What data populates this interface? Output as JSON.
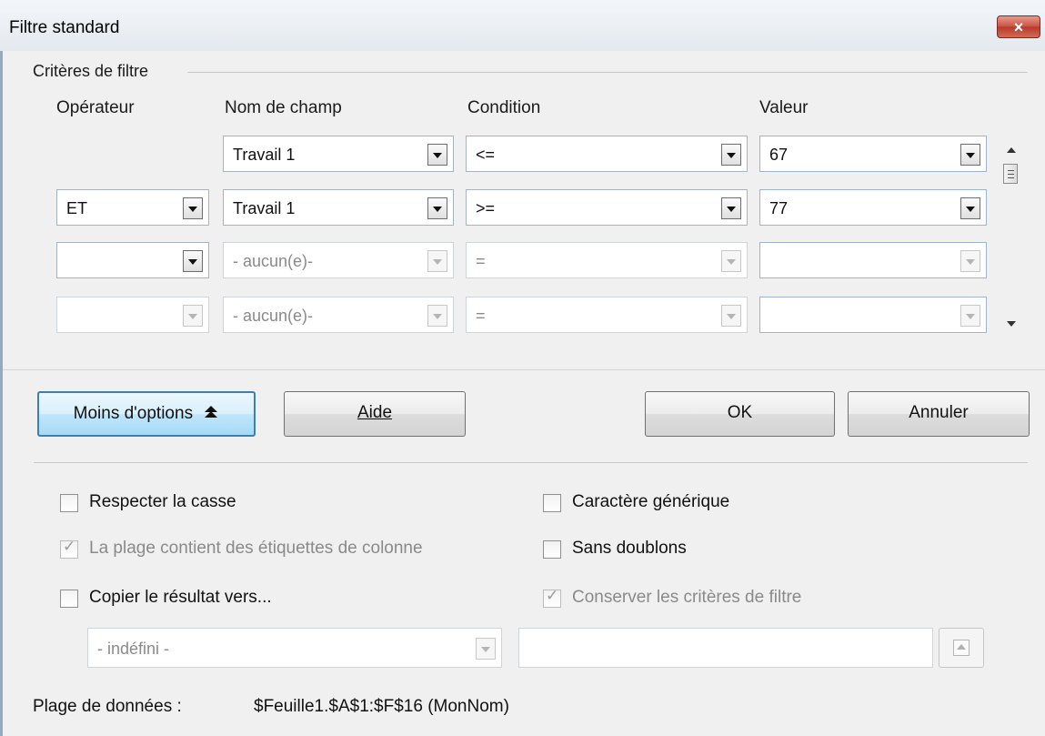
{
  "dialog": {
    "title": "Filtre standard",
    "close_glyph": "×"
  },
  "criteria": {
    "section_title": "Critères de filtre",
    "headers": {
      "operator": "Opérateur",
      "field": "Nom de champ",
      "condition": "Condition",
      "value": "Valeur"
    },
    "rows": [
      {
        "operator": "",
        "field": "Travail 1",
        "condition": "<=",
        "value": "67"
      },
      {
        "operator": "ET",
        "field": "Travail 1",
        "condition": ">=",
        "value": "77"
      },
      {
        "operator": "",
        "field": "- aucun(e)-",
        "condition": "=",
        "value": ""
      },
      {
        "operator": "",
        "field": "- aucun(e)-",
        "condition": "=",
        "value": ""
      }
    ]
  },
  "buttons": {
    "less_options": "Moins d'options",
    "less_options_icon": "double-chevron-up-icon",
    "help": "Aide",
    "ok": "OK",
    "cancel": "Annuler"
  },
  "options": {
    "case_sensitive": {
      "label": "Respecter la casse",
      "checked": false,
      "enabled": true
    },
    "wildcard": {
      "label": "Caractère générique",
      "checked": false,
      "enabled": true
    },
    "header_labels": {
      "label": "La plage contient des étiquettes de colonne",
      "checked": true,
      "enabled": false
    },
    "no_duplicates": {
      "label": "Sans doublons",
      "checked": false,
      "enabled": true
    },
    "copy_results": {
      "label": "Copier le résultat vers...",
      "checked": false,
      "enabled": true
    },
    "keep_criteria": {
      "label": "Conserver les critères de filtre",
      "checked": true,
      "enabled": false
    },
    "copy_target_select": "- indéfini -",
    "copy_target_input": ""
  },
  "data_range": {
    "label": "Plage de données :",
    "value": "$Feuille1.$A$1:$F$16 (MonNom)"
  }
}
